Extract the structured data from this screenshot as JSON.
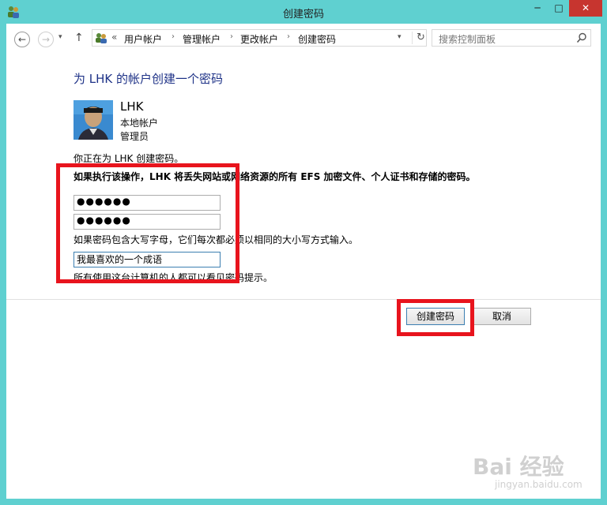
{
  "window": {
    "title": "创建密码",
    "controls": {
      "minimize": "─",
      "maximize": "□",
      "close": "✕"
    }
  },
  "nav": {
    "back_icon": "←",
    "forward_icon": "→",
    "recent_icon": "▾",
    "up_icon": "↑",
    "address_prefix": "«",
    "breadcrumb": [
      "用户帐户",
      "管理帐户",
      "更改帐户",
      "创建密码"
    ],
    "separator": "›",
    "dropdown_icon": "▾",
    "refresh_icon": "↻",
    "search_placeholder": "搜索控制面板"
  },
  "content": {
    "heading": "为 LHK 的帐户创建一个密码",
    "user": {
      "name": "LHK",
      "type": "本地帐户",
      "role": "管理员"
    },
    "intro": "你正在为 LHK 创建密码。",
    "warning": "如果执行该操作，LHK 将丢失网站或网络资源的所有 EFS 加密文件、个人证书和存储的密码。",
    "password_masked": "●●●●●●",
    "confirm_masked": "●●●●●●",
    "case_note": "如果密码包含大写字母，它们每次都必须以相同的大小写方式输入。",
    "hint_value": "我最喜欢的一个成语",
    "hint_note": "所有使用这台计算机的人都可以看见密码提示。"
  },
  "buttons": {
    "create": "创建密码",
    "cancel": "取消"
  },
  "watermark": {
    "main": "Bai 经验",
    "sub": "jingyan.baidu.com"
  },
  "colors": {
    "frame": "#5fd0d0",
    "heading": "#1e3287",
    "highlight": "#e8141d",
    "close": "#c7352f"
  }
}
